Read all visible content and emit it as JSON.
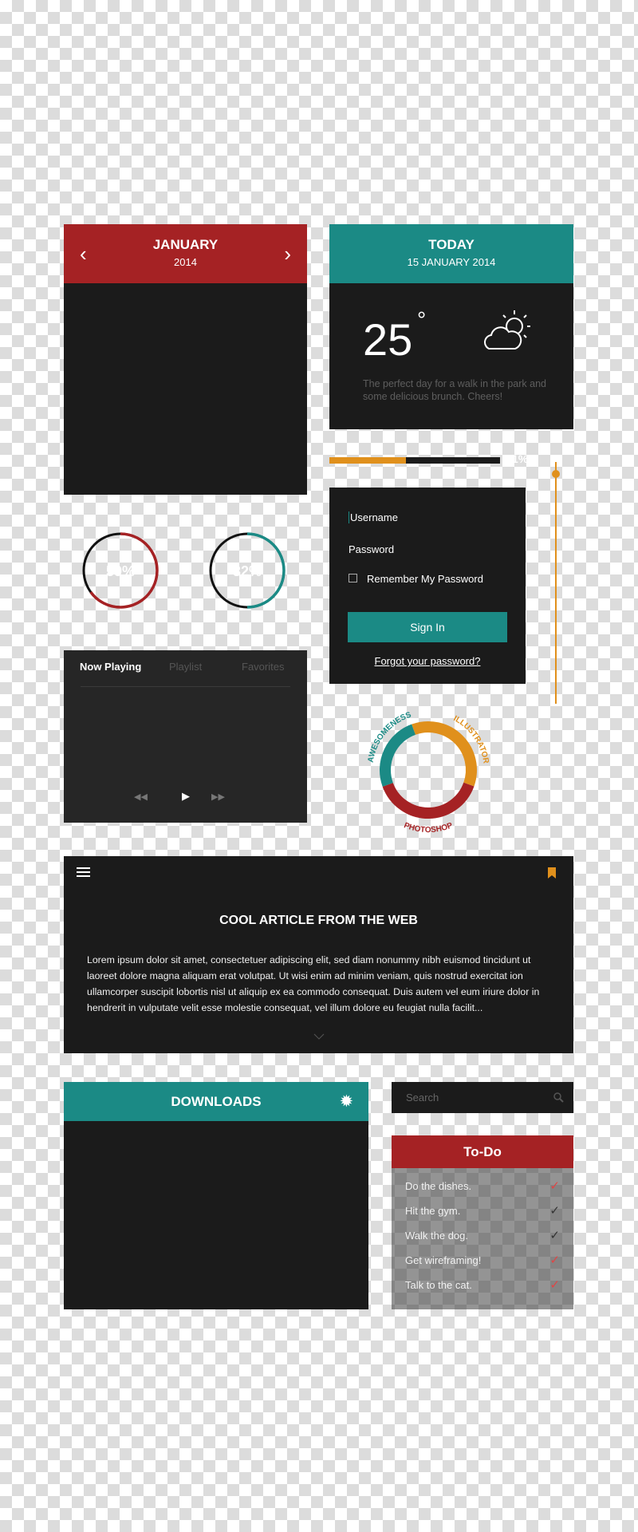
{
  "calendar": {
    "month": "JANUARY",
    "year": "2014",
    "prev_icon": "chevron-left-icon",
    "next_icon": "chevron-right-icon",
    "accent": "#a52224"
  },
  "weather": {
    "title": "TODAY",
    "date": "15 JANUARY 2014",
    "temperature": "25",
    "degree": "°",
    "icon": "partly-cloudy-icon",
    "description": "The perfect day for a walk in the park and some delicious brunch. Cheers!",
    "accent": "#1b8a85"
  },
  "progress": {
    "value_percent": 45,
    "label": "1%",
    "color": "#e0901c"
  },
  "vertical_slider": {
    "value_fraction": 0.95
  },
  "circles": [
    {
      "label": "59%",
      "value_percent": 65,
      "color": "#a52224"
    },
    {
      "label": "32%",
      "value_percent": 50,
      "color": "#1b8a85"
    }
  ],
  "login": {
    "username_placeholder": "Username",
    "password_placeholder": "Password",
    "remember_label": "Remember My Password",
    "remember_checked": false,
    "sign_in": "Sign In",
    "forgot": "Forgot your password?"
  },
  "player": {
    "tabs": [
      "Now Playing",
      "Playlist",
      "Favorites"
    ],
    "active_tab": 0
  },
  "donut": {
    "segments": [
      {
        "label": "ILLUSTRATOR",
        "color": "#e0901c",
        "share": 36
      },
      {
        "label": "PHOTOSHOP",
        "color": "#a52224",
        "share": 39
      },
      {
        "label": "AWESOMENESS",
        "color": "#1b8a85",
        "share": 25
      }
    ]
  },
  "article": {
    "title": "COOL ARTICLE FROM THE WEB",
    "body": "Lorem ipsum dolor sit amet, consectetuer adipiscing elit, sed diam nonummy nibh euismod tincidunt ut laoreet dolore magna aliquam erat volutpat. Ut wisi enim ad minim veniam, quis nostrud exercitat ion ullamcorper suscipit lobortis nisl ut aliquip ex ea commodo consequat. Duis autem vel eum iriure dolor in hendrerit in vulputate velit esse molestie consequat, vel illum dolore eu feugiat nulla facilit...",
    "bookmark_color": "#e0901c"
  },
  "downloads": {
    "title": "DOWNLOADS"
  },
  "search": {
    "placeholder": "Search"
  },
  "todo": {
    "title": "To-Do",
    "items": [
      {
        "text": "Do the dishes.",
        "done": true
      },
      {
        "text": "Hit the gym.",
        "done": false
      },
      {
        "text": "Walk the dog.",
        "done": false
      },
      {
        "text": "Get wireframing!",
        "done": true
      },
      {
        "text": "Talk to the cat.",
        "done": true
      }
    ]
  }
}
